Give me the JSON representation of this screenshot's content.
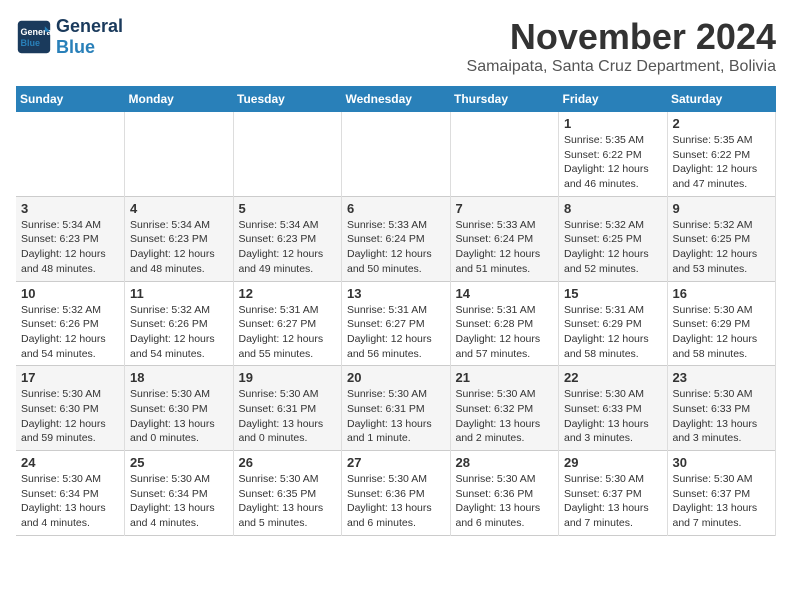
{
  "header": {
    "logo_line1": "General",
    "logo_line2": "Blue",
    "month": "November 2024",
    "location": "Samaipata, Santa Cruz Department, Bolivia"
  },
  "weekdays": [
    "Sunday",
    "Monday",
    "Tuesday",
    "Wednesday",
    "Thursday",
    "Friday",
    "Saturday"
  ],
  "weeks": [
    [
      {
        "day": "",
        "info": ""
      },
      {
        "day": "",
        "info": ""
      },
      {
        "day": "",
        "info": ""
      },
      {
        "day": "",
        "info": ""
      },
      {
        "day": "",
        "info": ""
      },
      {
        "day": "1",
        "info": "Sunrise: 5:35 AM\nSunset: 6:22 PM\nDaylight: 12 hours and 46 minutes."
      },
      {
        "day": "2",
        "info": "Sunrise: 5:35 AM\nSunset: 6:22 PM\nDaylight: 12 hours and 47 minutes."
      }
    ],
    [
      {
        "day": "3",
        "info": "Sunrise: 5:34 AM\nSunset: 6:23 PM\nDaylight: 12 hours and 48 minutes."
      },
      {
        "day": "4",
        "info": "Sunrise: 5:34 AM\nSunset: 6:23 PM\nDaylight: 12 hours and 48 minutes."
      },
      {
        "day": "5",
        "info": "Sunrise: 5:34 AM\nSunset: 6:23 PM\nDaylight: 12 hours and 49 minutes."
      },
      {
        "day": "6",
        "info": "Sunrise: 5:33 AM\nSunset: 6:24 PM\nDaylight: 12 hours and 50 minutes."
      },
      {
        "day": "7",
        "info": "Sunrise: 5:33 AM\nSunset: 6:24 PM\nDaylight: 12 hours and 51 minutes."
      },
      {
        "day": "8",
        "info": "Sunrise: 5:32 AM\nSunset: 6:25 PM\nDaylight: 12 hours and 52 minutes."
      },
      {
        "day": "9",
        "info": "Sunrise: 5:32 AM\nSunset: 6:25 PM\nDaylight: 12 hours and 53 minutes."
      }
    ],
    [
      {
        "day": "10",
        "info": "Sunrise: 5:32 AM\nSunset: 6:26 PM\nDaylight: 12 hours and 54 minutes."
      },
      {
        "day": "11",
        "info": "Sunrise: 5:32 AM\nSunset: 6:26 PM\nDaylight: 12 hours and 54 minutes."
      },
      {
        "day": "12",
        "info": "Sunrise: 5:31 AM\nSunset: 6:27 PM\nDaylight: 12 hours and 55 minutes."
      },
      {
        "day": "13",
        "info": "Sunrise: 5:31 AM\nSunset: 6:27 PM\nDaylight: 12 hours and 56 minutes."
      },
      {
        "day": "14",
        "info": "Sunrise: 5:31 AM\nSunset: 6:28 PM\nDaylight: 12 hours and 57 minutes."
      },
      {
        "day": "15",
        "info": "Sunrise: 5:31 AM\nSunset: 6:29 PM\nDaylight: 12 hours and 58 minutes."
      },
      {
        "day": "16",
        "info": "Sunrise: 5:30 AM\nSunset: 6:29 PM\nDaylight: 12 hours and 58 minutes."
      }
    ],
    [
      {
        "day": "17",
        "info": "Sunrise: 5:30 AM\nSunset: 6:30 PM\nDaylight: 12 hours and 59 minutes."
      },
      {
        "day": "18",
        "info": "Sunrise: 5:30 AM\nSunset: 6:30 PM\nDaylight: 13 hours and 0 minutes."
      },
      {
        "day": "19",
        "info": "Sunrise: 5:30 AM\nSunset: 6:31 PM\nDaylight: 13 hours and 0 minutes."
      },
      {
        "day": "20",
        "info": "Sunrise: 5:30 AM\nSunset: 6:31 PM\nDaylight: 13 hours and 1 minute."
      },
      {
        "day": "21",
        "info": "Sunrise: 5:30 AM\nSunset: 6:32 PM\nDaylight: 13 hours and 2 minutes."
      },
      {
        "day": "22",
        "info": "Sunrise: 5:30 AM\nSunset: 6:33 PM\nDaylight: 13 hours and 3 minutes."
      },
      {
        "day": "23",
        "info": "Sunrise: 5:30 AM\nSunset: 6:33 PM\nDaylight: 13 hours and 3 minutes."
      }
    ],
    [
      {
        "day": "24",
        "info": "Sunrise: 5:30 AM\nSunset: 6:34 PM\nDaylight: 13 hours and 4 minutes."
      },
      {
        "day": "25",
        "info": "Sunrise: 5:30 AM\nSunset: 6:34 PM\nDaylight: 13 hours and 4 minutes."
      },
      {
        "day": "26",
        "info": "Sunrise: 5:30 AM\nSunset: 6:35 PM\nDaylight: 13 hours and 5 minutes."
      },
      {
        "day": "27",
        "info": "Sunrise: 5:30 AM\nSunset: 6:36 PM\nDaylight: 13 hours and 6 minutes."
      },
      {
        "day": "28",
        "info": "Sunrise: 5:30 AM\nSunset: 6:36 PM\nDaylight: 13 hours and 6 minutes."
      },
      {
        "day": "29",
        "info": "Sunrise: 5:30 AM\nSunset: 6:37 PM\nDaylight: 13 hours and 7 minutes."
      },
      {
        "day": "30",
        "info": "Sunrise: 5:30 AM\nSunset: 6:37 PM\nDaylight: 13 hours and 7 minutes."
      }
    ]
  ]
}
